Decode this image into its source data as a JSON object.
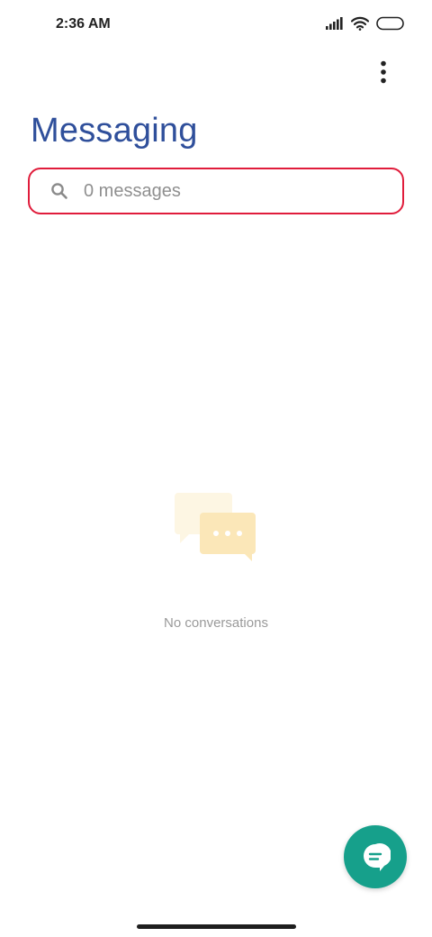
{
  "status_bar": {
    "time": "2:36 AM"
  },
  "header": {
    "title": "Messaging",
    "overflow_icon": "more-vert-icon"
  },
  "search": {
    "placeholder": "0 messages",
    "value": "",
    "icon": "search-icon",
    "border_color": "#e01c3b"
  },
  "empty_state": {
    "icon": "chat-bubbles-icon",
    "text": "No conversations"
  },
  "fab": {
    "icon": "new-message-icon",
    "color": "#16a08b"
  },
  "colors": {
    "title": "#2f4f9b",
    "accent": "#16a08b"
  }
}
